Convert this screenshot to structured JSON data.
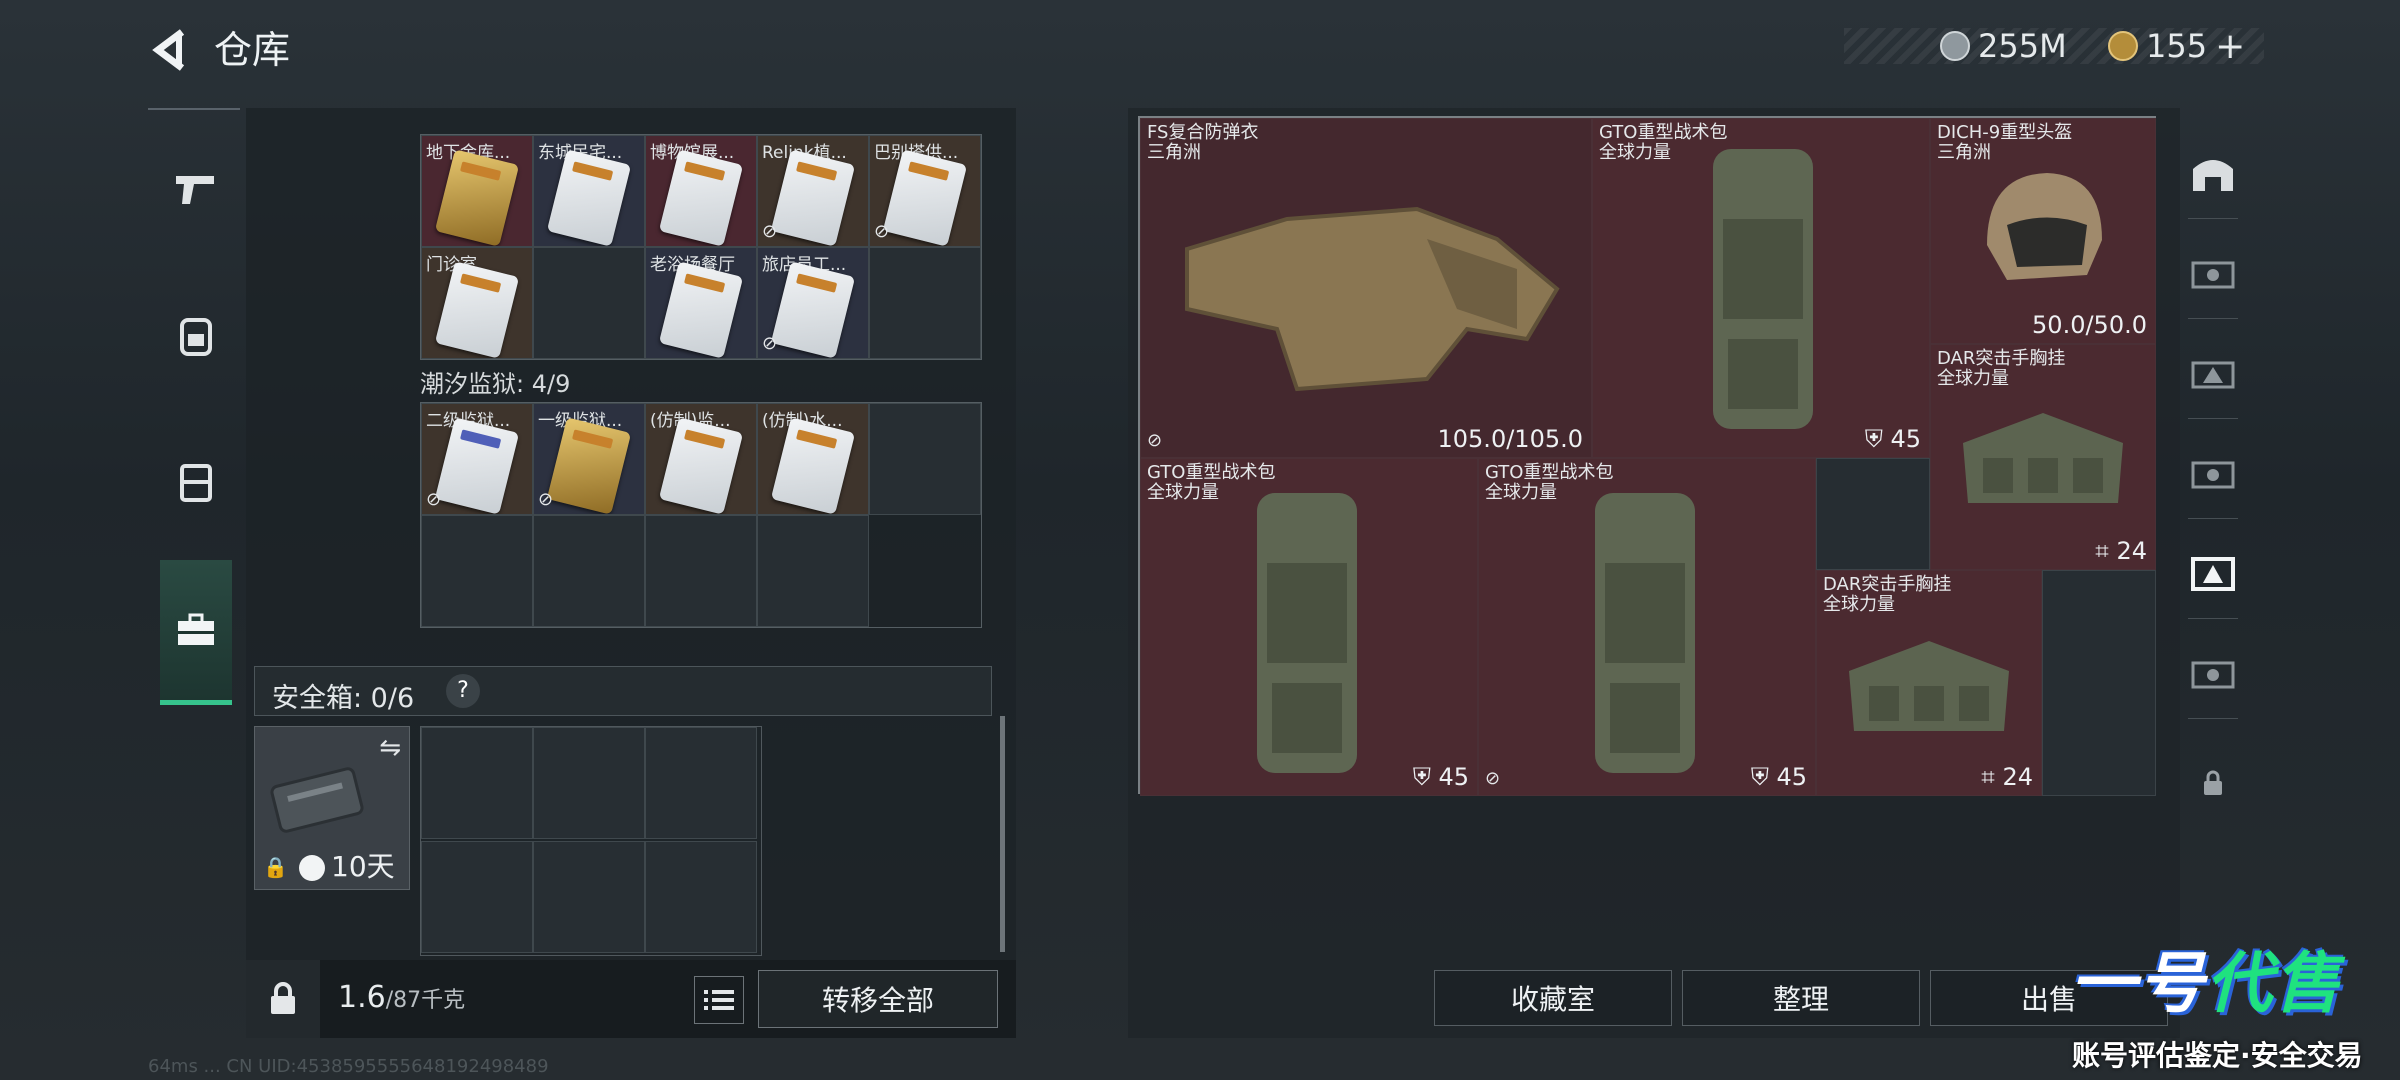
{
  "header": {
    "title": "仓库"
  },
  "currency": {
    "money": "255M",
    "coupons": "155",
    "add_label": "+",
    "money_color": "#9aa4aa",
    "coupon_color": "#c9a24a"
  },
  "left_nav": {
    "items": [
      {
        "icon": "pistol-icon"
      },
      {
        "icon": "backpack-icon"
      },
      {
        "icon": "vest-icon"
      },
      {
        "icon": "toolbox-icon",
        "active": true
      }
    ]
  },
  "keycards": {
    "top_rows": [
      [
        {
          "label": "地下金库...",
          "style": "red",
          "card": "gold"
        },
        {
          "label": "东城民宅...",
          "style": "navy",
          "card": "white"
        },
        {
          "label": "博物馆展...",
          "style": "red",
          "card": "white"
        },
        {
          "label": "Relink植...",
          "style": "brown",
          "card": "white",
          "locked": true
        },
        {
          "label": "巴别塔供...",
          "style": "brown",
          "card": "white",
          "locked": true
        }
      ],
      [
        {
          "label": "门诊室",
          "style": "brown",
          "card": "white"
        },
        {
          "label": "",
          "style": "dark",
          "card": null
        },
        {
          "label": "老浴场餐厅",
          "style": "navy",
          "card": "white"
        },
        {
          "label": "旅店员工...",
          "style": "navy",
          "card": "white",
          "locked": true
        }
      ]
    ],
    "section_title": "潮汐监狱: 4/9",
    "prison_row": [
      {
        "label": "二级监狱...",
        "style": "brown",
        "card": "blue",
        "locked": true
      },
      {
        "label": "一级监狱...",
        "style": "navy",
        "card": "gold",
        "locked": true
      },
      {
        "label": "(仿制)监...",
        "style": "brown",
        "card": "white"
      },
      {
        "label": "(仿制)水...",
        "style": "brown",
        "card": "white"
      }
    ]
  },
  "safe_box": {
    "title": "安全箱: 0/6",
    "help": "?",
    "duration": "10天"
  },
  "bottom": {
    "weight_current": "1.6",
    "weight_max": "/87千克",
    "transfer_all": "转移全部"
  },
  "stash_items": [
    {
      "name": "FS复合防弹衣",
      "sub": "三角洲",
      "value": "105.0/105.0",
      "type": "armor"
    },
    {
      "name": "GTO重型战术包",
      "sub": "全球力量",
      "value": "45",
      "type": "backpack"
    },
    {
      "name": "DICH-9重型头盔",
      "sub": "三角洲",
      "value": "50.0/50.0",
      "type": "helmet"
    },
    {
      "name": "DAR突击手胸挂",
      "sub": "全球力量",
      "value": "24",
      "type": "rig"
    },
    {
      "name": "GTO重型战术包",
      "sub": "全球力量",
      "value": "45",
      "type": "backpack"
    },
    {
      "name": "GTO重型战术包",
      "sub": "全球力量",
      "value": "45",
      "type": "backpack"
    },
    {
      "name": "DAR突击手胸挂",
      "sub": "全球力量",
      "value": "24",
      "type": "rig"
    }
  ],
  "actions": {
    "collection": "收藏室",
    "sort": "整理",
    "sell": "出售"
  },
  "watermark": {
    "logo_a": "一号",
    "logo_b": "代售",
    "subtitle": "账号评估鉴定·安全交易"
  },
  "status": {
    "text": "64ms ... CN UID:4538595555648192498489"
  }
}
